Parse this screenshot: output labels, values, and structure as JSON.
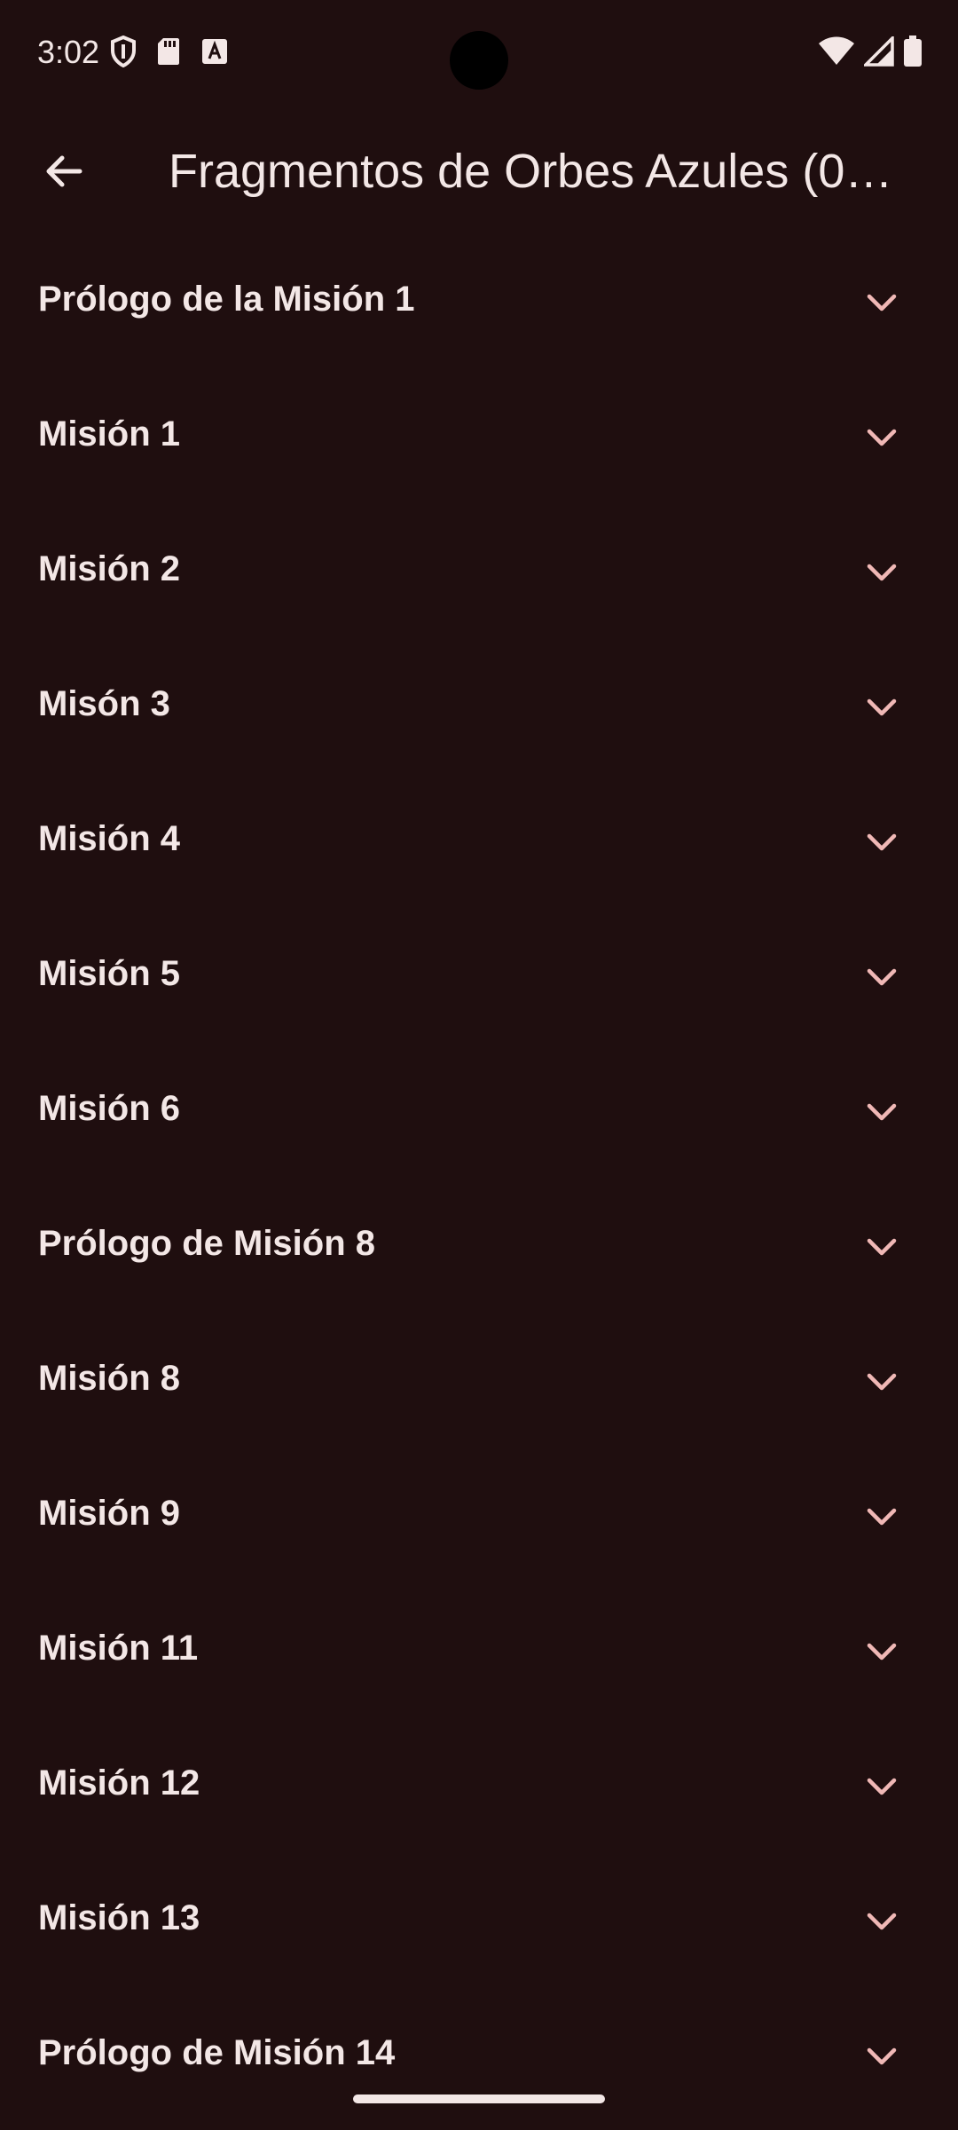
{
  "status_bar": {
    "time": "3:02",
    "left_icons": [
      "shield-icon",
      "sd-card-icon",
      "keyboard-a-icon"
    ],
    "right_icons": [
      "wifi-icon",
      "cell-signal-icon",
      "battery-icon"
    ]
  },
  "app_bar": {
    "back_icon": "arrow-back-icon",
    "title": "Fragmentos de Orbes Azules (0…"
  },
  "missions": [
    {
      "label": "Prólogo de la Misión 1"
    },
    {
      "label": "Misión 1"
    },
    {
      "label": "Misión 2"
    },
    {
      "label": "Misón 3"
    },
    {
      "label": "Misión 4"
    },
    {
      "label": "Misión 5"
    },
    {
      "label": "Misión 6"
    },
    {
      "label": "Prólogo de Misión 8"
    },
    {
      "label": "Misión 8"
    },
    {
      "label": "Misión 9"
    },
    {
      "label": "Misión 11"
    },
    {
      "label": "Misión 12"
    },
    {
      "label": "Misión 13"
    },
    {
      "label": "Prólogo de Misión 14"
    }
  ],
  "colors": {
    "background": "#1f0e0f",
    "text": "#f3e7e6",
    "chevron": "#f0b8b6"
  }
}
